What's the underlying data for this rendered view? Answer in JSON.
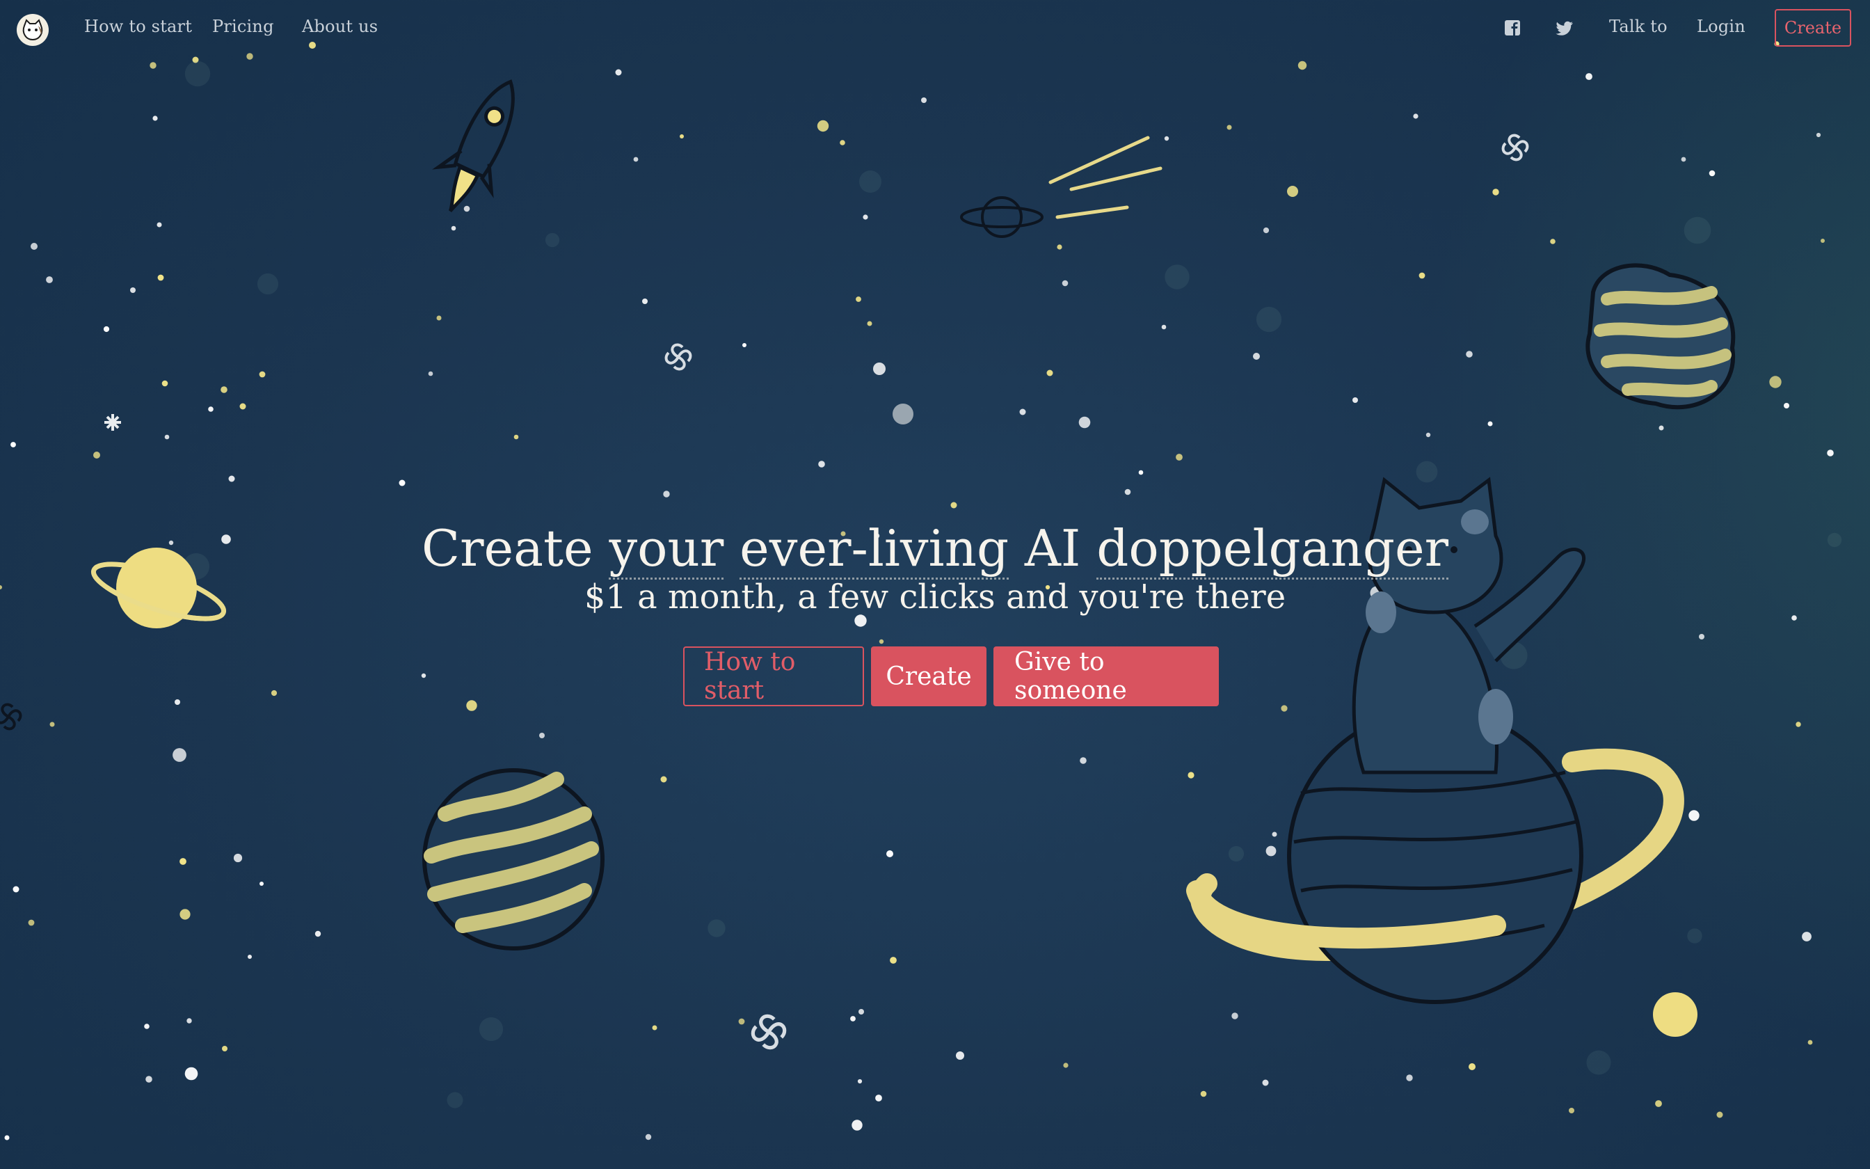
{
  "nav": {
    "links": [
      {
        "label": "How to start"
      },
      {
        "label": "Pricing"
      },
      {
        "label": "About us"
      }
    ],
    "right_links": [
      {
        "label": "Talk to"
      },
      {
        "label": "Login"
      }
    ],
    "social_icons": [
      "facebook-icon",
      "twitter-icon"
    ],
    "create_label": "Create"
  },
  "hero": {
    "title_parts": [
      "Create",
      "your",
      "ever-living",
      "AI",
      "doppelganger"
    ],
    "subtitle": "$1 a month, a few clicks and you're there",
    "buttons": {
      "how_to_start": "How to start",
      "create": "Create",
      "give": "Give to someone"
    }
  },
  "colors": {
    "background": "#1b3550",
    "accent": "#d9535f",
    "star": "#f3e68a",
    "text": "#f6f3ec"
  }
}
